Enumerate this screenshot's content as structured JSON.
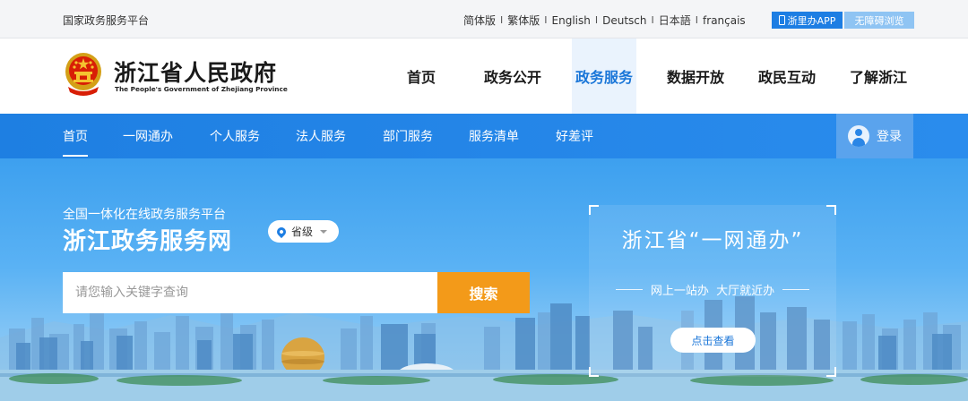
{
  "topbar": {
    "platform_label": "国家政务服务平台",
    "languages": [
      "简体版",
      "繁体版",
      "English",
      "Deutsch",
      "日本語",
      "français"
    ],
    "separator": "I",
    "app_button": "浙里办APP",
    "accessibility_button": "无障碍浏览"
  },
  "header": {
    "title": "浙江省人民政府",
    "title_en": "The People's Government of Zhejiang Province",
    "nav": [
      "首页",
      "政务公开",
      "政务服务",
      "数据开放",
      "政民互动",
      "了解浙江"
    ],
    "active_nav": "政务服务"
  },
  "subnav": {
    "items": [
      "首页",
      "一网通办",
      "个人服务",
      "法人服务",
      "部门服务",
      "服务清单",
      "好差评"
    ],
    "active": "首页",
    "login_label": "登录"
  },
  "hero": {
    "subtitle": "全国一体化在线政务服务平台",
    "title": "浙江政务服务网",
    "region_label": "省级",
    "search_placeholder": "请您输入关键字查询",
    "search_button": "搜索"
  },
  "promo": {
    "title": "浙江省“一网通办”",
    "subtitle": "网上一站办  大厅就近办",
    "button": "点击查看"
  },
  "colors": {
    "primary_blue": "#1e7fe2",
    "search_orange": "#f39a19",
    "active_nav_text": "#1a76d8"
  },
  "icons": [
    "national-emblem-icon",
    "phone-icon",
    "user-avatar-icon",
    "location-pin-icon",
    "caret-down-icon"
  ]
}
